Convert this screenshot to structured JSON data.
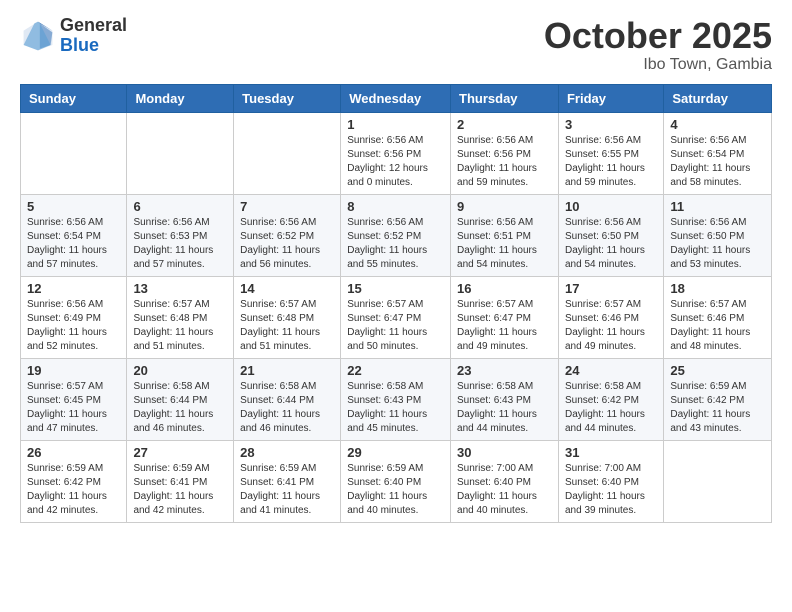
{
  "header": {
    "logo": {
      "general": "General",
      "blue": "Blue"
    },
    "title": "October 2025",
    "location": "Ibo Town, Gambia"
  },
  "calendar": {
    "days_of_week": [
      "Sunday",
      "Monday",
      "Tuesday",
      "Wednesday",
      "Thursday",
      "Friday",
      "Saturday"
    ],
    "weeks": [
      [
        {
          "day": "",
          "info": ""
        },
        {
          "day": "",
          "info": ""
        },
        {
          "day": "",
          "info": ""
        },
        {
          "day": "1",
          "info": "Sunrise: 6:56 AM\nSunset: 6:56 PM\nDaylight: 12 hours\nand 0 minutes."
        },
        {
          "day": "2",
          "info": "Sunrise: 6:56 AM\nSunset: 6:56 PM\nDaylight: 11 hours\nand 59 minutes."
        },
        {
          "day": "3",
          "info": "Sunrise: 6:56 AM\nSunset: 6:55 PM\nDaylight: 11 hours\nand 59 minutes."
        },
        {
          "day": "4",
          "info": "Sunrise: 6:56 AM\nSunset: 6:54 PM\nDaylight: 11 hours\nand 58 minutes."
        }
      ],
      [
        {
          "day": "5",
          "info": "Sunrise: 6:56 AM\nSunset: 6:54 PM\nDaylight: 11 hours\nand 57 minutes."
        },
        {
          "day": "6",
          "info": "Sunrise: 6:56 AM\nSunset: 6:53 PM\nDaylight: 11 hours\nand 57 minutes."
        },
        {
          "day": "7",
          "info": "Sunrise: 6:56 AM\nSunset: 6:52 PM\nDaylight: 11 hours\nand 56 minutes."
        },
        {
          "day": "8",
          "info": "Sunrise: 6:56 AM\nSunset: 6:52 PM\nDaylight: 11 hours\nand 55 minutes."
        },
        {
          "day": "9",
          "info": "Sunrise: 6:56 AM\nSunset: 6:51 PM\nDaylight: 11 hours\nand 54 minutes."
        },
        {
          "day": "10",
          "info": "Sunrise: 6:56 AM\nSunset: 6:50 PM\nDaylight: 11 hours\nand 54 minutes."
        },
        {
          "day": "11",
          "info": "Sunrise: 6:56 AM\nSunset: 6:50 PM\nDaylight: 11 hours\nand 53 minutes."
        }
      ],
      [
        {
          "day": "12",
          "info": "Sunrise: 6:56 AM\nSunset: 6:49 PM\nDaylight: 11 hours\nand 52 minutes."
        },
        {
          "day": "13",
          "info": "Sunrise: 6:57 AM\nSunset: 6:48 PM\nDaylight: 11 hours\nand 51 minutes."
        },
        {
          "day": "14",
          "info": "Sunrise: 6:57 AM\nSunset: 6:48 PM\nDaylight: 11 hours\nand 51 minutes."
        },
        {
          "day": "15",
          "info": "Sunrise: 6:57 AM\nSunset: 6:47 PM\nDaylight: 11 hours\nand 50 minutes."
        },
        {
          "day": "16",
          "info": "Sunrise: 6:57 AM\nSunset: 6:47 PM\nDaylight: 11 hours\nand 49 minutes."
        },
        {
          "day": "17",
          "info": "Sunrise: 6:57 AM\nSunset: 6:46 PM\nDaylight: 11 hours\nand 49 minutes."
        },
        {
          "day": "18",
          "info": "Sunrise: 6:57 AM\nSunset: 6:46 PM\nDaylight: 11 hours\nand 48 minutes."
        }
      ],
      [
        {
          "day": "19",
          "info": "Sunrise: 6:57 AM\nSunset: 6:45 PM\nDaylight: 11 hours\nand 47 minutes."
        },
        {
          "day": "20",
          "info": "Sunrise: 6:58 AM\nSunset: 6:44 PM\nDaylight: 11 hours\nand 46 minutes."
        },
        {
          "day": "21",
          "info": "Sunrise: 6:58 AM\nSunset: 6:44 PM\nDaylight: 11 hours\nand 46 minutes."
        },
        {
          "day": "22",
          "info": "Sunrise: 6:58 AM\nSunset: 6:43 PM\nDaylight: 11 hours\nand 45 minutes."
        },
        {
          "day": "23",
          "info": "Sunrise: 6:58 AM\nSunset: 6:43 PM\nDaylight: 11 hours\nand 44 minutes."
        },
        {
          "day": "24",
          "info": "Sunrise: 6:58 AM\nSunset: 6:42 PM\nDaylight: 11 hours\nand 44 minutes."
        },
        {
          "day": "25",
          "info": "Sunrise: 6:59 AM\nSunset: 6:42 PM\nDaylight: 11 hours\nand 43 minutes."
        }
      ],
      [
        {
          "day": "26",
          "info": "Sunrise: 6:59 AM\nSunset: 6:42 PM\nDaylight: 11 hours\nand 42 minutes."
        },
        {
          "day": "27",
          "info": "Sunrise: 6:59 AM\nSunset: 6:41 PM\nDaylight: 11 hours\nand 42 minutes."
        },
        {
          "day": "28",
          "info": "Sunrise: 6:59 AM\nSunset: 6:41 PM\nDaylight: 11 hours\nand 41 minutes."
        },
        {
          "day": "29",
          "info": "Sunrise: 6:59 AM\nSunset: 6:40 PM\nDaylight: 11 hours\nand 40 minutes."
        },
        {
          "day": "30",
          "info": "Sunrise: 7:00 AM\nSunset: 6:40 PM\nDaylight: 11 hours\nand 40 minutes."
        },
        {
          "day": "31",
          "info": "Sunrise: 7:00 AM\nSunset: 6:40 PM\nDaylight: 11 hours\nand 39 minutes."
        },
        {
          "day": "",
          "info": ""
        }
      ]
    ]
  }
}
